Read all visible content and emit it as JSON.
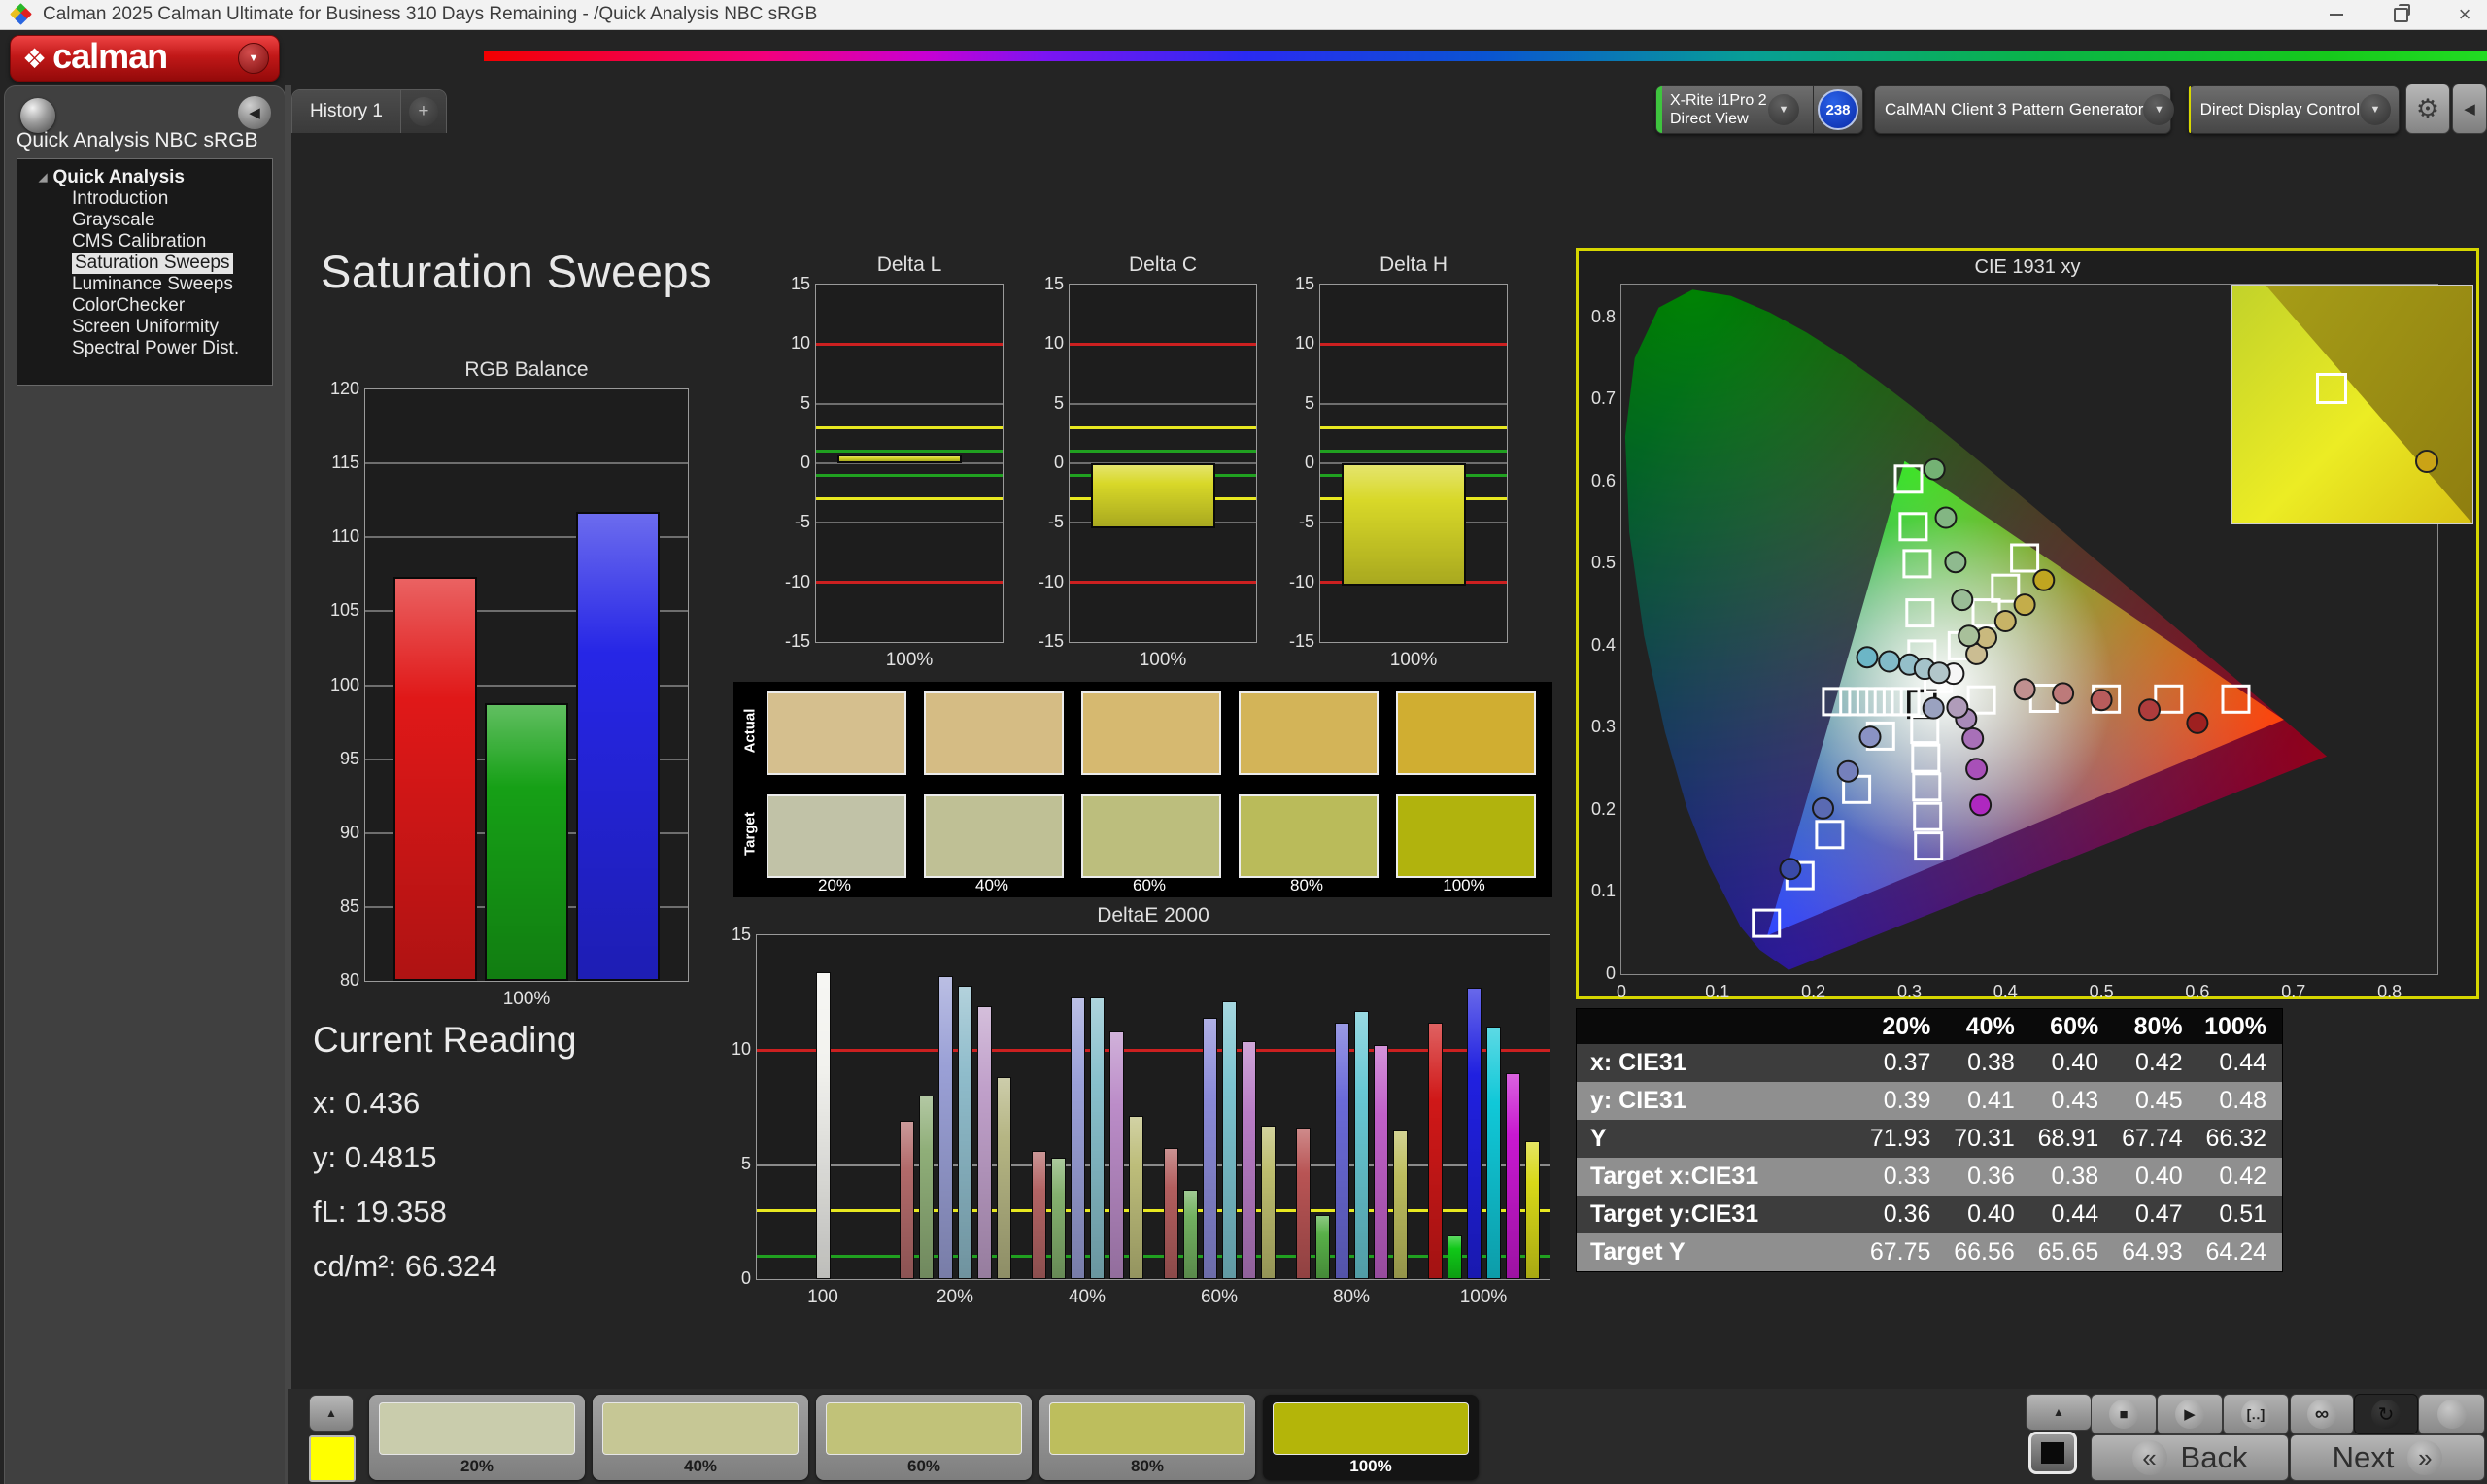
{
  "window": {
    "title": "Calman 2025 Calman Ultimate for Business 310 Days Remaining  - /Quick Analysis NBC sRGB"
  },
  "brand": {
    "logo_text": "calman"
  },
  "tabs": {
    "history": "History 1",
    "add": "+"
  },
  "toolbar": {
    "meter_line1": "X-Rite i1Pro 2",
    "meter_line2": "Direct View",
    "meter_badge": "238",
    "pattern_generator": "CalMAN Client 3 Pattern Generator",
    "display_control": "Direct Display Control",
    "accent_green": "#3ec43e",
    "accent_yellow": "#d8d800"
  },
  "sidebar": {
    "header": "Quick Analysis NBC sRGB",
    "root": "Quick Analysis",
    "items": [
      {
        "label": "Introduction",
        "selected": false
      },
      {
        "label": "Grayscale",
        "selected": false
      },
      {
        "label": "CMS Calibration",
        "selected": false
      },
      {
        "label": "Saturation Sweeps",
        "selected": true
      },
      {
        "label": "Luminance Sweeps",
        "selected": false
      },
      {
        "label": "ColorChecker",
        "selected": false
      },
      {
        "label": "Screen Uniformity",
        "selected": false
      },
      {
        "label": "Spectral Power Dist.",
        "selected": false
      }
    ]
  },
  "page": {
    "title": "Saturation Sweeps"
  },
  "current_reading": {
    "title": "Current Reading",
    "lines": [
      "x: 0.436",
      "y: 0.4815",
      "fL: 19.358",
      "cd/m²: 66.324"
    ]
  },
  "chart_data": [
    {
      "id": "rgb_balance",
      "type": "bar",
      "title": "RGB Balance",
      "categories": [
        "Red",
        "Green",
        "Blue"
      ],
      "values": [
        107.3,
        98.8,
        111.7
      ],
      "bar_colors": [
        "#e01818",
        "#16a016",
        "#2626e6"
      ],
      "ylim": [
        80,
        120
      ],
      "yticks": [
        120,
        115,
        110,
        105,
        100,
        95,
        90,
        85,
        80
      ],
      "xlabel": "100%",
      "grid": true
    },
    {
      "id": "delta_l",
      "type": "bar",
      "title": "Delta L",
      "values": [
        0.7
      ],
      "bar_color": "#d8d828",
      "ylim": [
        -15,
        15
      ],
      "yticks": [
        15,
        10,
        5,
        0,
        -5,
        -10,
        -15
      ],
      "ref_lines": [
        {
          "y": 10,
          "color": "#cc2020"
        },
        {
          "y": -10,
          "color": "#cc2020"
        },
        {
          "y": 3,
          "color": "#e8e820"
        },
        {
          "y": -3,
          "color": "#e8e820"
        },
        {
          "y": 1,
          "color": "#20a020"
        },
        {
          "y": -1,
          "color": "#20a020"
        }
      ],
      "xlabel": "100%"
    },
    {
      "id": "delta_c",
      "type": "bar",
      "title": "Delta C",
      "values": [
        -5.5
      ],
      "bar_color": "#d8d828",
      "ylim": [
        -15,
        15
      ],
      "yticks": [
        15,
        10,
        5,
        0,
        -5,
        -10,
        -15
      ],
      "ref_lines": [
        {
          "y": 10,
          "color": "#cc2020"
        },
        {
          "y": -10,
          "color": "#cc2020"
        },
        {
          "y": 3,
          "color": "#e8e820"
        },
        {
          "y": -3,
          "color": "#e8e820"
        },
        {
          "y": 1,
          "color": "#20a020"
        },
        {
          "y": -1,
          "color": "#20a020"
        }
      ],
      "xlabel": "100%"
    },
    {
      "id": "delta_h",
      "type": "bar",
      "title": "Delta H",
      "values": [
        -10.3
      ],
      "bar_color": "#d8d828",
      "ylim": [
        -15,
        15
      ],
      "yticks": [
        15,
        10,
        5,
        0,
        -5,
        -10,
        -15
      ],
      "ref_lines": [
        {
          "y": 10,
          "color": "#cc2020"
        },
        {
          "y": -10,
          "color": "#cc2020"
        },
        {
          "y": 3,
          "color": "#e8e820"
        },
        {
          "y": -3,
          "color": "#e8e820"
        },
        {
          "y": 1,
          "color": "#20a020"
        },
        {
          "y": -1,
          "color": "#20a020"
        }
      ],
      "xlabel": "100%"
    },
    {
      "id": "saturation_swatches",
      "type": "table",
      "columns": [
        "20%",
        "40%",
        "60%",
        "80%",
        "100%"
      ],
      "rows": [
        {
          "label": "Actual",
          "colors": [
            "#d5bf8e",
            "#d5bc84",
            "#d6b970",
            "#d3b458",
            "#d0ae31"
          ]
        },
        {
          "label": "Target",
          "colors": [
            "#c1c2a7",
            "#bfc095",
            "#bcbe7d",
            "#babb5a",
            "#b1b30d"
          ]
        }
      ]
    },
    {
      "id": "deltae_2000",
      "type": "bar",
      "title": "DeltaE 2000",
      "ylim": [
        0,
        15
      ],
      "yticks": [
        15,
        10,
        5,
        0
      ],
      "ref_lines": [
        {
          "y": 10,
          "color": "#cc2020"
        },
        {
          "y": 5,
          "color": "#8a8a8a"
        },
        {
          "y": 3,
          "color": "#e8e820"
        },
        {
          "y": 1,
          "color": "#20a020"
        }
      ],
      "groups": [
        {
          "label": "100",
          "values": [
            13.4
          ],
          "colors": [
            "#f2f2ee"
          ]
        },
        {
          "label": "20%",
          "values": [
            6.9,
            8.0,
            13.2,
            12.8,
            11.9,
            8.8
          ],
          "colors": [
            "#b26a6a",
            "#8fae78",
            "#9aa0d6",
            "#8fbccb",
            "#c0a0ca",
            "#b5b583"
          ]
        },
        {
          "label": "40%",
          "values": [
            5.6,
            5.3,
            12.3,
            12.3,
            10.8,
            7.1
          ],
          "colors": [
            "#b26464",
            "#84b06e",
            "#9aa0d8",
            "#88c0cc",
            "#bb8cc8",
            "#bdbd7a"
          ]
        },
        {
          "label": "60%",
          "values": [
            5.7,
            3.9,
            11.4,
            12.1,
            10.4,
            6.7
          ],
          "colors": [
            "#b25e5e",
            "#72b060",
            "#8a8ad8",
            "#7cc4d0",
            "#b87cc6",
            "#bdbd6e"
          ]
        },
        {
          "label": "80%",
          "values": [
            6.6,
            2.8,
            11.2,
            11.7,
            10.2,
            6.5
          ],
          "colors": [
            "#b85454",
            "#58b048",
            "#6a6ad8",
            "#68c8d4",
            "#c060c8",
            "#bdbd5e"
          ]
        },
        {
          "label": "100%",
          "values": [
            11.2,
            1.9,
            12.7,
            11.0,
            9.0,
            6.0
          ],
          "colors": [
            "#d01818",
            "#10c818",
            "#2020e0",
            "#10c8d8",
            "#c818d0",
            "#d8d818"
          ]
        }
      ]
    },
    {
      "id": "cie_1931",
      "type": "scatter",
      "title": "CIE 1931 xy",
      "xlim": [
        0,
        0.85
      ],
      "ylim": [
        0,
        0.84
      ],
      "xticks": [
        "0",
        "0.1",
        "0.2",
        "0.3",
        "0.4",
        "0.5",
        "0.6",
        "0.7",
        "0.8"
      ],
      "yticks": [
        "0",
        "0.1",
        "0.2",
        "0.3",
        "0.4",
        "0.5",
        "0.6",
        "0.7",
        "0.8"
      ],
      "border_color": "#d6d600",
      "targets": [
        {
          "x": 0.313,
          "y": 0.329,
          "center": true
        },
        {
          "x": 0.375,
          "y": 0.334
        },
        {
          "x": 0.44,
          "y": 0.336
        },
        {
          "x": 0.505,
          "y": 0.335
        },
        {
          "x": 0.57,
          "y": 0.335
        },
        {
          "x": 0.64,
          "y": 0.335
        },
        {
          "x": 0.313,
          "y": 0.39
        },
        {
          "x": 0.311,
          "y": 0.44
        },
        {
          "x": 0.308,
          "y": 0.5
        },
        {
          "x": 0.304,
          "y": 0.545
        },
        {
          "x": 0.299,
          "y": 0.603
        },
        {
          "x": 0.27,
          "y": 0.29
        },
        {
          "x": 0.245,
          "y": 0.225
        },
        {
          "x": 0.217,
          "y": 0.17
        },
        {
          "x": 0.186,
          "y": 0.12
        },
        {
          "x": 0.151,
          "y": 0.062
        },
        {
          "x": 0.296,
          "y": 0.332
        },
        {
          "x": 0.278,
          "y": 0.332
        },
        {
          "x": 0.26,
          "y": 0.332
        },
        {
          "x": 0.242,
          "y": 0.332
        },
        {
          "x": 0.224,
          "y": 0.332
        },
        {
          "x": 0.316,
          "y": 0.298
        },
        {
          "x": 0.317,
          "y": 0.263
        },
        {
          "x": 0.318,
          "y": 0.228
        },
        {
          "x": 0.319,
          "y": 0.192
        },
        {
          "x": 0.32,
          "y": 0.156
        },
        {
          "x": 0.33,
          "y": 0.36
        },
        {
          "x": 0.355,
          "y": 0.4
        },
        {
          "x": 0.38,
          "y": 0.44
        },
        {
          "x": 0.4,
          "y": 0.47
        },
        {
          "x": 0.42,
          "y": 0.507
        }
      ],
      "measurements": [
        {
          "x": 0.346,
          "y": 0.366,
          "color": "#f6f6f6"
        },
        {
          "x": 0.37,
          "y": 0.39,
          "color": "#cbbd92"
        },
        {
          "x": 0.38,
          "y": 0.41,
          "color": "#c9b97e"
        },
        {
          "x": 0.4,
          "y": 0.43,
          "color": "#c7b366"
        },
        {
          "x": 0.42,
          "y": 0.45,
          "color": "#c4ad4a"
        },
        {
          "x": 0.44,
          "y": 0.48,
          "color": "#c0a520"
        },
        {
          "x": 0.42,
          "y": 0.347,
          "color": "#c09090"
        },
        {
          "x": 0.46,
          "y": 0.342,
          "color": "#bd7a7a"
        },
        {
          "x": 0.5,
          "y": 0.334,
          "color": "#b85c5c"
        },
        {
          "x": 0.55,
          "y": 0.322,
          "color": "#ae3c3c"
        },
        {
          "x": 0.6,
          "y": 0.306,
          "color": "#9e2020"
        },
        {
          "x": 0.326,
          "y": 0.615,
          "color": "#74b274"
        },
        {
          "x": 0.338,
          "y": 0.556,
          "color": "#83b683"
        },
        {
          "x": 0.348,
          "y": 0.502,
          "color": "#8fba8f"
        },
        {
          "x": 0.355,
          "y": 0.456,
          "color": "#9abd96"
        },
        {
          "x": 0.362,
          "y": 0.412,
          "color": "#a8c09a"
        },
        {
          "x": 0.256,
          "y": 0.386,
          "color": "#6cb6c6"
        },
        {
          "x": 0.279,
          "y": 0.381,
          "color": "#82bac8"
        },
        {
          "x": 0.3,
          "y": 0.377,
          "color": "#94bfc9"
        },
        {
          "x": 0.316,
          "y": 0.372,
          "color": "#a4c3ca"
        },
        {
          "x": 0.331,
          "y": 0.367,
          "color": "#b2c6ca"
        },
        {
          "x": 0.176,
          "y": 0.128,
          "color": "#3a4aa8"
        },
        {
          "x": 0.21,
          "y": 0.202,
          "color": "#5a6ab2"
        },
        {
          "x": 0.236,
          "y": 0.247,
          "color": "#7580bc"
        },
        {
          "x": 0.259,
          "y": 0.289,
          "color": "#8a92c4"
        },
        {
          "x": 0.325,
          "y": 0.324,
          "color": "#9aa2c0"
        },
        {
          "x": 0.374,
          "y": 0.206,
          "color": "#ae28c0"
        },
        {
          "x": 0.37,
          "y": 0.25,
          "color": "#a850b8"
        },
        {
          "x": 0.366,
          "y": 0.287,
          "color": "#a870b8"
        },
        {
          "x": 0.359,
          "y": 0.311,
          "color": "#a88ab8"
        },
        {
          "x": 0.35,
          "y": 0.325,
          "color": "#b09cba"
        }
      ],
      "inset": {
        "square": {
          "x": 0.4,
          "y": 0.42
        },
        "circle": {
          "x": 0.8,
          "y": 0.73,
          "color": "#caa316"
        }
      }
    },
    {
      "id": "results_table",
      "type": "table",
      "columns": [
        "20%",
        "40%",
        "60%",
        "80%",
        "100%"
      ],
      "rows": [
        {
          "label": "x: CIE31",
          "values": [
            "0.37",
            "0.38",
            "0.40",
            "0.42",
            "0.44"
          ]
        },
        {
          "label": "y: CIE31",
          "values": [
            "0.39",
            "0.41",
            "0.43",
            "0.45",
            "0.48"
          ]
        },
        {
          "label": "Y",
          "values": [
            "71.93",
            "70.31",
            "68.91",
            "67.74",
            "66.32"
          ]
        },
        {
          "label": "Target x:CIE31",
          "values": [
            "0.33",
            "0.36",
            "0.38",
            "0.40",
            "0.42"
          ]
        },
        {
          "label": "Target y:CIE31",
          "values": [
            "0.36",
            "0.40",
            "0.44",
            "0.47",
            "0.51"
          ]
        },
        {
          "label": "Target Y",
          "values": [
            "67.75",
            "66.56",
            "65.65",
            "64.93",
            "64.24"
          ]
        }
      ]
    }
  ],
  "footer": {
    "swatches": [
      {
        "label": "20%",
        "color": "#c9ccac",
        "selected": false
      },
      {
        "label": "40%",
        "color": "#c6c795",
        "selected": false
      },
      {
        "label": "60%",
        "color": "#c1c279",
        "selected": false
      },
      {
        "label": "80%",
        "color": "#bdbe5d",
        "selected": false
      },
      {
        "label": "100%",
        "color": "#b4b509",
        "selected": true
      }
    ],
    "back": "Back",
    "next": "Next"
  }
}
